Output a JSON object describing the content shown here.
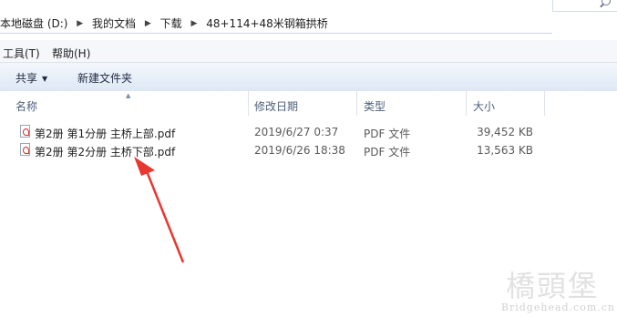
{
  "address": {
    "crumbs": [
      "本地磁盘 (D:)",
      "我的文档",
      "下载",
      "48+114+48米钢箱拱桥"
    ]
  },
  "menubar": {
    "items": [
      "工具(T)",
      "帮助(H)"
    ]
  },
  "toolbar": {
    "share_label": "共享",
    "new_folder_label": "新建文件夹"
  },
  "columns": {
    "name": "名称",
    "date": "修改日期",
    "type": "类型",
    "size": "大小"
  },
  "files": [
    {
      "name": "第2册 第1分册 主桥上部.pdf",
      "date": "2019/6/27 0:37",
      "type": "PDF 文件",
      "size": "39,452 KB"
    },
    {
      "name": "第2册 第2分册 主桥下部.pdf",
      "date": "2019/6/26 18:38",
      "type": "PDF 文件",
      "size": "13,563 KB"
    }
  ],
  "watermark": {
    "cn": "橋頭堡",
    "en": "Bridgehead.com.cn"
  },
  "colors": {
    "arrow": "#e8372f",
    "toolbar": "#dde8f4",
    "header_text": "#4c607a"
  }
}
